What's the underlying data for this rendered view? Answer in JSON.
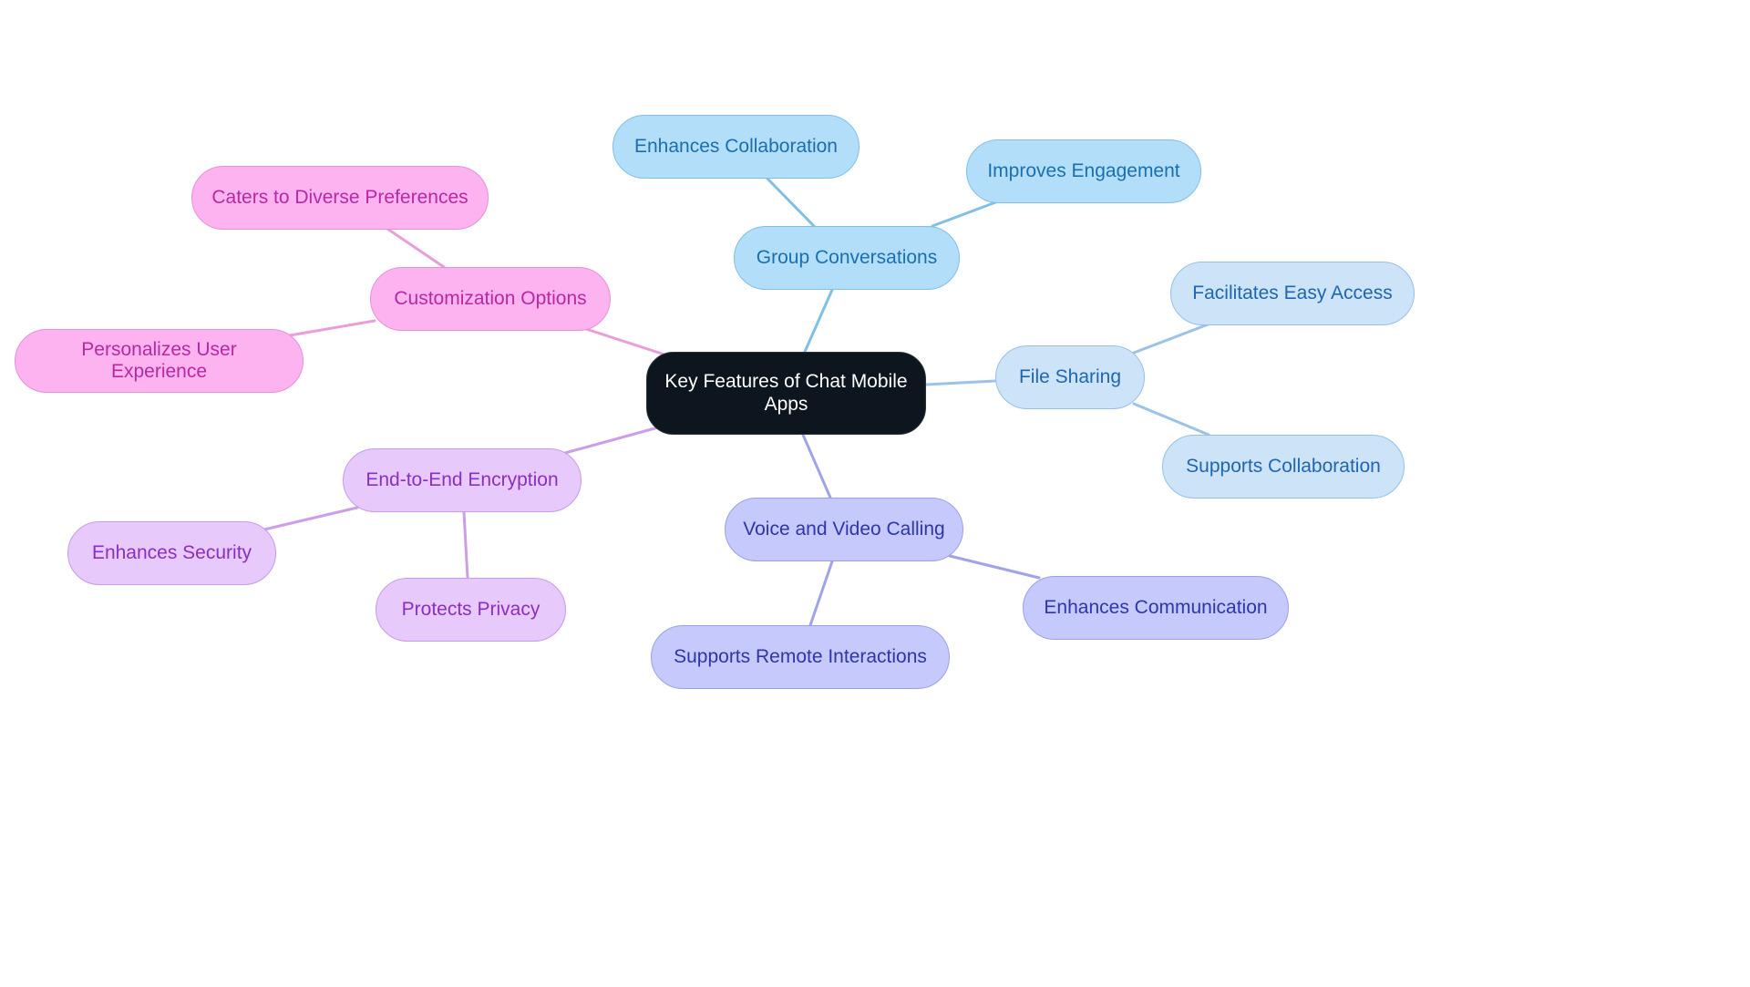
{
  "diagram": {
    "type": "mindmap",
    "root": {
      "id": "root",
      "label": "Key Features of Chat Mobile Apps"
    },
    "branches": [
      {
        "id": "group",
        "label": "Group Conversations",
        "color_class": "c-blue",
        "edge_color": "#80bfe6",
        "children": [
          {
            "id": "group-c1",
            "label": "Enhances Collaboration"
          },
          {
            "id": "group-c2",
            "label": "Improves Engagement"
          }
        ]
      },
      {
        "id": "file",
        "label": "File Sharing",
        "color_class": "c-lblue",
        "edge_color": "#9cc2e8",
        "children": [
          {
            "id": "file-c1",
            "label": "Facilitates Easy Access"
          },
          {
            "id": "file-c2",
            "label": "Supports Collaboration"
          }
        ]
      },
      {
        "id": "voice",
        "label": "Voice and Video Calling",
        "color_class": "c-indigo",
        "edge_color": "#9fa3e8",
        "children": [
          {
            "id": "voice-c1",
            "label": "Enhances Communication"
          },
          {
            "id": "voice-c2",
            "label": "Supports Remote Interactions"
          }
        ]
      },
      {
        "id": "e2e",
        "label": "End-to-End Encryption",
        "color_class": "c-purple",
        "edge_color": "#cc9ee8",
        "children": [
          {
            "id": "e2e-c1",
            "label": "Enhances Security"
          },
          {
            "id": "e2e-c2",
            "label": "Protects Privacy"
          }
        ]
      },
      {
        "id": "custom",
        "label": "Customization Options",
        "color_class": "c-pink",
        "edge_color": "#ea9ed9",
        "children": [
          {
            "id": "custom-c1",
            "label": "Caters to Diverse Preferences"
          },
          {
            "id": "custom-c2",
            "label": "Personalizes User Experience"
          }
        ]
      }
    ]
  }
}
